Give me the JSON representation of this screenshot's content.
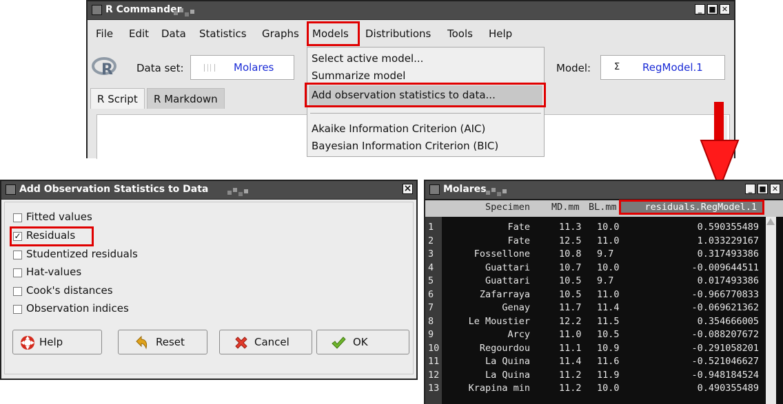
{
  "rcmdr": {
    "title": "R Commander",
    "menubar": [
      "File",
      "Edit",
      "Data",
      "Statistics",
      "Graphs",
      "Models",
      "Distributions",
      "Tools",
      "Help"
    ],
    "dataset_label": "Data set:",
    "dataset_value": "Molares",
    "model_label": "Model:",
    "model_symbol": "Σ",
    "model_value": "RegModel.1",
    "tabs": [
      "R Script",
      "R Markdown"
    ],
    "models_menu": {
      "items": [
        "Select active model...",
        "Summarize model",
        "Add observation statistics to data...",
        "Akaike Information Criterion (AIC)",
        "Bayesian Information Criterion (BIC)"
      ]
    }
  },
  "dialog": {
    "title": "Add Observation Statistics to Data",
    "close_glyph": "×",
    "options": [
      {
        "label": "Fitted values",
        "checked": false
      },
      {
        "label": "Residuals",
        "checked": true
      },
      {
        "label": "Studentized residuals",
        "checked": false
      },
      {
        "label": "Hat-values",
        "checked": false
      },
      {
        "label": "Cook's distances",
        "checked": false
      },
      {
        "label": "Observation indices",
        "checked": false
      }
    ],
    "buttons": {
      "help": "Help",
      "reset": "Reset",
      "cancel": "Cancel",
      "ok": "OK"
    }
  },
  "viewer": {
    "title": "Molares",
    "headers": [
      "Specimen",
      "MD.mm",
      "BL.mm",
      "residuals.RegModel.1"
    ],
    "rows": [
      {
        "n": "1",
        "specimen": "Fate",
        "md": "11.3",
        "bl": "10.0",
        "res": "0.590355489"
      },
      {
        "n": "2",
        "specimen": "Fate",
        "md": "12.5",
        "bl": "11.0",
        "res": "1.033229167"
      },
      {
        "n": "3",
        "specimen": "Fossellone",
        "md": "10.8",
        "bl": "9.7",
        "res": "0.317493386"
      },
      {
        "n": "4",
        "specimen": "Guattari",
        "md": "10.7",
        "bl": "10.0",
        "res": "-0.009644511"
      },
      {
        "n": "5",
        "specimen": "Guattari",
        "md": "10.5",
        "bl": "9.7",
        "res": "0.017493386"
      },
      {
        "n": "6",
        "specimen": "Zafarraya",
        "md": "10.5",
        "bl": "11.0",
        "res": "-0.966770833"
      },
      {
        "n": "7",
        "specimen": "Genay",
        "md": "11.7",
        "bl": "11.4",
        "res": "-0.069621362"
      },
      {
        "n": "8",
        "specimen": "Le Moustier",
        "md": "12.2",
        "bl": "11.5",
        "res": "0.354666005"
      },
      {
        "n": "9",
        "specimen": "Arcy",
        "md": "11.0",
        "bl": "10.5",
        "res": "-0.088207672"
      },
      {
        "n": "10",
        "specimen": "Regourdou",
        "md": "11.1",
        "bl": "10.9",
        "res": "-0.291058201"
      },
      {
        "n": "11",
        "specimen": "La Quina",
        "md": "11.4",
        "bl": "11.6",
        "res": "-0.521046627"
      },
      {
        "n": "12",
        "specimen": "La Quina",
        "md": "11.2",
        "bl": "11.9",
        "res": "-0.948184524"
      },
      {
        "n": "13",
        "specimen": "Krapina min",
        "md": "11.2",
        "bl": "10.0",
        "res": "0.490355489"
      }
    ]
  },
  "colors": {
    "highlight": "#e00000",
    "link_blue": "#1a2bd6",
    "titlebar": "#4b4b4b",
    "viewer_bg": "#0f0f0f",
    "viewer_text": "#e8e8e8"
  },
  "icons": [
    "r-logo-icon",
    "dataset-icon",
    "sigma-icon",
    "help-lifebuoy-icon",
    "reset-arrow-icon",
    "cancel-x-icon",
    "ok-check-icon",
    "arrow-down-icon"
  ]
}
